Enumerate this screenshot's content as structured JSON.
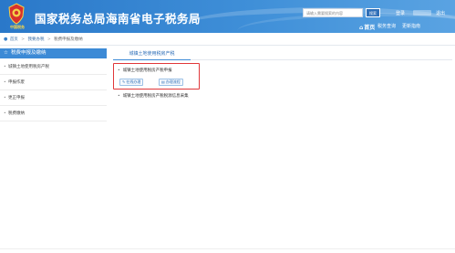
{
  "header": {
    "site_title": "国家税务总局海南省电子税务局",
    "emblem_text": "中国税务",
    "search_placeholder": "请输入需要搜索的内容",
    "search_button": "搜索",
    "login_link": "登录",
    "logout_link": "退出",
    "nav": {
      "home": "首页",
      "check": "税务查询",
      "guide": "更新指南"
    }
  },
  "breadcrumb": {
    "items": [
      "首页",
      "我要办税",
      "税费申报及缴纳"
    ]
  },
  "sidebar": {
    "title": "税费申报及缴纳",
    "items": [
      {
        "label": "城镇土地使用税房产税"
      },
      {
        "label": "申报作废"
      },
      {
        "label": "更正申报"
      },
      {
        "label": "税费缴纳"
      }
    ]
  },
  "main": {
    "tab": "城镇土地使用税房产税",
    "items": [
      {
        "label": "城镇土地使用税房产税申报"
      },
      {
        "label": "城镇土地使用税房产税税源信息采集"
      }
    ],
    "actions": {
      "online_fill": "在线办理",
      "view_process": "办理流程"
    }
  },
  "colors": {
    "header_blue": "#2a78c9",
    "sidebar_head": "#3c8ad6",
    "highlight_red": "#e0373a"
  }
}
